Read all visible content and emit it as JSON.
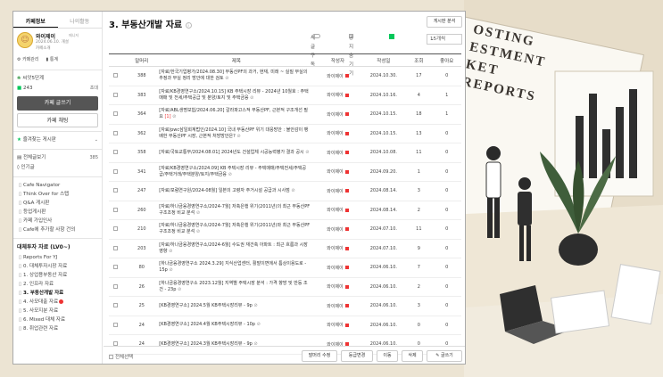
{
  "background": {
    "title_text": "OSTING\nESTMENT\nKET REPORTS",
    "colors": {
      "wall": "#ece4d3",
      "desk": "#f1ebde",
      "plant": "#3f5e3b",
      "board": "#ffffff"
    }
  },
  "sidebar": {
    "tabs": [
      {
        "label": "카페정보",
        "active": true
      },
      {
        "label": "나의활동",
        "active": false
      }
    ],
    "cafe": {
      "name": "와이제이",
      "grade": "매니저",
      "date": "2024.06.10. 개설",
      "intro": "카페소개",
      "links": [
        "카페관리",
        "통계"
      ]
    },
    "members": {
      "level_label": "씨앗5단계",
      "count_label": "243",
      "invite_label": "초대"
    },
    "write_button": "카페 글쓰기",
    "chat_button": "카페 채팅",
    "favorites_label": "즐겨찾는 게시판",
    "all_posts": {
      "label": "전체글보기",
      "count": "385"
    },
    "popular_label": "인기글",
    "menu_top": [
      "Cafe Navigator",
      "Think Over for 스텝",
      "Q&A 게시판",
      "등업게시판",
      "카페 가입인사",
      "Cafe에 추가할 사항 건의"
    ],
    "section_title": "대체투자 자료 (LV0~)",
    "menu_items": [
      {
        "label": "Reports For YJ",
        "active": false,
        "new": false
      },
      {
        "label": "0. 대체투자시장 자료",
        "active": false,
        "new": false
      },
      {
        "label": "1. 상업용부동산 자료",
        "active": false,
        "new": false
      },
      {
        "label": "2. 인프라 자료",
        "active": false,
        "new": false
      },
      {
        "label": "3. 부동산개발 자료",
        "active": true,
        "new": false
      },
      {
        "label": "4. 사모대출 자료",
        "active": false,
        "new": true
      },
      {
        "label": "5. 사모지분 자료",
        "active": false,
        "new": false
      },
      {
        "label": "6. Mixed 대체 자료",
        "active": false,
        "new": false
      },
      {
        "label": "8. 취업관련 자료",
        "active": false,
        "new": false
      }
    ]
  },
  "main": {
    "title": "3. 부동산개발 자료",
    "board_info_button": "게시판 분석",
    "subscribe_label": "새글 구독",
    "notice_hide_label": "공지 숨기기",
    "page_size": "15개씩",
    "columns": {
      "prefix": "말머리",
      "title": "제목",
      "author": "작성자",
      "date": "작성일",
      "views": "조회",
      "likes": "좋아요"
    },
    "rows": [
      {
        "id": "388",
        "title": "[자료/한국기업평가/2024.08.30] 부동산PF의 과거, 현재, 미래 ~ 실질 부실의 추정과 부실 정리 방안에 대한 검토",
        "comments": "",
        "author": "와이제이",
        "date": "2024.10.30.",
        "views": "17",
        "likes": "0"
      },
      {
        "id": "383",
        "title": "[자료/KB경영연구소/2024.10.15] KB 주택시장 리뷰 - 2024년 10월호 : 주택매매 및 전세/주택공급 및 분양/토지 및 주택금융",
        "comments": "",
        "author": "와이제이",
        "date": "2024.10.16.",
        "views": "4",
        "likes": "1"
      },
      {
        "id": "364",
        "title": "[자료/ABL생명보험/2024.06.20] 갈라파고스적 부동산PF, 근본적 구조개선 필요",
        "comments": "[1]",
        "author": "와이제이",
        "date": "2024.10.15.",
        "views": "18",
        "likes": "1"
      },
      {
        "id": "362",
        "title": "[자료/pwc삼일회계법인/2024.10] 국내 부동산PF 위기 대응방안 : 불안감이 팽배한 부동산PF 시장, 근본적 처방방안은?",
        "comments": "",
        "author": "와이제이",
        "date": "2024.10.15.",
        "views": "13",
        "likes": "0"
      },
      {
        "id": "358",
        "title": "[자료/국토교통부/2024.08.01] 2024년도 건설업체 시공능력평가 결과 공시",
        "comments": "",
        "author": "와이제이",
        "date": "2024.10.08.",
        "views": "11",
        "likes": "0"
      },
      {
        "id": "341",
        "title": "[자료/KB경영연구소/2024.09] KB 주택시장 리뷰 - 주택매매/주택전세/주택공급/주택거래/주택분양/토지/주택금융",
        "comments": "",
        "author": "와이제이",
        "date": "2024.09.20.",
        "views": "1",
        "likes": "0"
      },
      {
        "id": "247",
        "title": "[자료/포럼연구원/2024-08월] 일본의 고령자 주거시설 공급과 시사점",
        "comments": "",
        "author": "와이제이",
        "date": "2024.08.14.",
        "views": "3",
        "likes": "0"
      },
      {
        "id": "260",
        "title": "[자료/하나금융경영연구소/2024-7월] 저축은행 위기(2011년)의 최근 부동산PF 구조조정 비교 분석",
        "comments": "",
        "author": "와이제이",
        "date": "2024.08.14.",
        "views": "2",
        "likes": "0"
      },
      {
        "id": "210",
        "title": "[자료/하나금융경영연구소/2024-7월] 저축은행 위기(2011년)와 최근 부동산PF 구조조정 비교 분석",
        "comments": "",
        "author": "와이제이",
        "date": "2024.07.10.",
        "views": "11",
        "likes": "0"
      },
      {
        "id": "203",
        "title": "[자료/하나금융경영연구소/2024-6월] 수도권 재건축 아파트 : 최근 흐름과 시장 영향",
        "comments": "",
        "author": "와이제이",
        "date": "2024.07.10.",
        "views": "9",
        "likes": "0"
      },
      {
        "id": "80",
        "title": "[하나금융경영연구소 2024.3.29] 지식산업센터, 활발이면에서 틈상이용도로 - 15p",
        "comments": "",
        "author": "와이제이",
        "date": "2024.06.10.",
        "views": "7",
        "likes": "0"
      },
      {
        "id": "26",
        "title": "[하나금융경영연구소 2023.12월] 지역별 주택시장 분석 : 가격 향방 및 반등 조건 - 23p",
        "comments": "",
        "author": "와이제이",
        "date": "2024.06.10.",
        "views": "2",
        "likes": "0"
      },
      {
        "id": "25",
        "title": "[KB경영연구소] 2024.5월 KB주택시장리뷰 - 9p",
        "comments": "",
        "author": "와이제이",
        "date": "2024.06.10.",
        "views": "3",
        "likes": "0"
      },
      {
        "id": "24",
        "title": "[KB경영연구소] 2024.4월 KB주택시장리뷰 - 10p",
        "comments": "",
        "author": "와이제이",
        "date": "2024.06.10.",
        "views": "0",
        "likes": "0"
      },
      {
        "id": "24",
        "title": "[KB경영연구소] 2024.3월 KB주택시장리뷰 - 9p",
        "comments": "",
        "author": "와이제이",
        "date": "2024.06.10.",
        "views": "0",
        "likes": "0"
      }
    ],
    "footer": {
      "select_all": "전체선택",
      "buttons": [
        "말머리 수정",
        "등급변경",
        "이동",
        "삭제",
        "글쓰기"
      ]
    }
  }
}
